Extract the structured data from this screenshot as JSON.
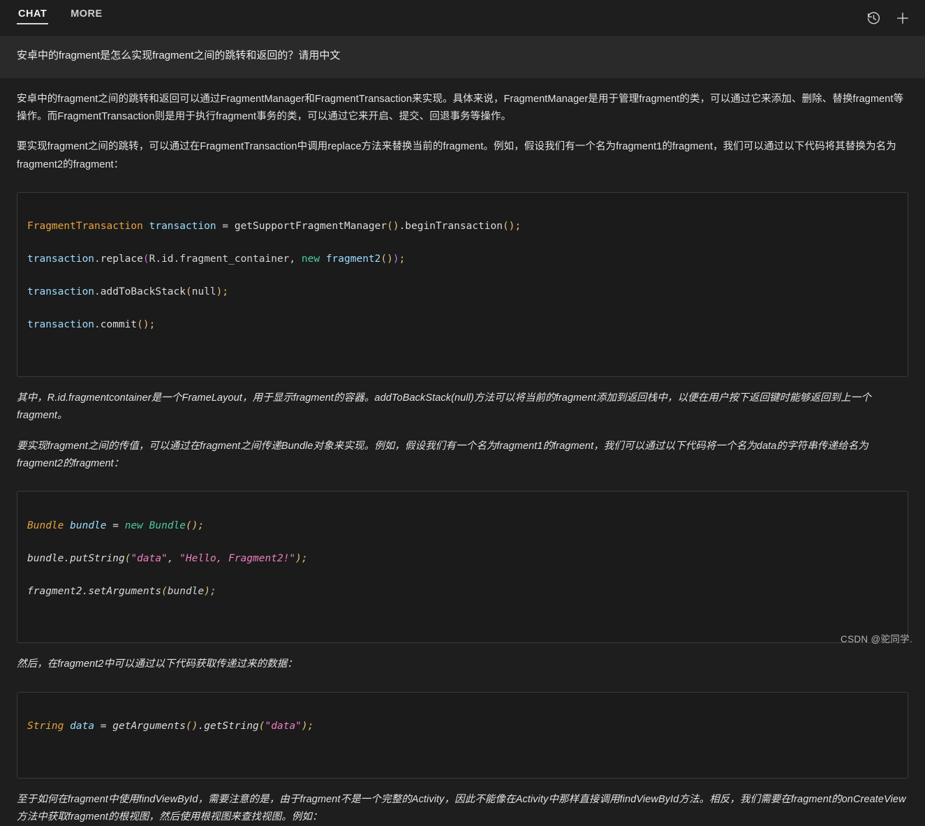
{
  "app": {
    "tabs": [
      {
        "label": "CHAT",
        "active": true
      },
      {
        "label": "MORE",
        "active": false
      }
    ],
    "actions": [
      {
        "name": "history-icon",
        "label": "History"
      },
      {
        "name": "new-chat-icon",
        "label": "New chat"
      }
    ],
    "colors": {
      "background": "#1e1e1e",
      "user_row_background": "#2a2a2a",
      "code_background": "#1b1b1b",
      "code_border": "#3a3a3a",
      "text": "#e3e3e3",
      "accent_type": "#e8a33d",
      "accent_variable": "#9cdcfe",
      "accent_keyword": "#4ec9a7",
      "accent_string": "#ef7ec0",
      "accent_paren": "#e5c07b"
    }
  },
  "conversation": {
    "user_question": "安卓中的fragment是怎么实现fragment之间的跳转和返回的？请用中文",
    "paragraphs": {
      "p1": "安卓中的fragment之间的跳转和返回可以通过FragmentManager和FragmentTransaction来实现。具体来说，FragmentManager是用于管理fragment的类，可以通过它来添加、删除、替换fragment等操作。而FragmentTransaction则是用于执行fragment事务的类，可以通过它来开启、提交、回退事务等操作。",
      "p2": "要实现fragment之间的跳转，可以通过在FragmentTransaction中调用replace方法来替换当前的fragment。例如，假设我们有一个名为fragment1的fragment，我们可以通过以下代码将其替换为名为fragment2的fragment：",
      "p3": "其中，R.id.fragmentcontainer是一个FrameLayout，用于显示fragment的容器。addToBackStack(null)方法可以将当前的fragment添加到返回栈中，以便在用户按下返回键时能够返回到上一个fragment。",
      "p4": "要实现fragment之间的传值，可以通过在fragment之间传递Bundle对象来实现。例如，假设我们有一个名为fragment1的fragment，我们可以通过以下代码将一个名为data的字符串传递给名为fragment2的fragment：",
      "p5": "然后，在fragment2中可以通过以下代码获取传递过来的数据：",
      "p6": "至于如何在fragment中使用findViewById，需要注意的是，由于fragment不是一个完整的Activity，因此不能像在Activity中那样直接调用findViewById方法。相反，我们需要在fragment的onCreateView方法中获取fragment的根视图，然后使用根视图来查找视图。例如："
    },
    "code_blocks": {
      "block1": {
        "language": "java",
        "italic": false,
        "lines": [
          "FragmentTransaction transaction = getSupportFragmentManager().beginTransaction();",
          "transaction.replace(R.id.fragment_container, new fragment2());",
          "transaction.addToBackStack(null);",
          "transaction.commit();"
        ]
      },
      "block2": {
        "language": "java",
        "italic": true,
        "lines": [
          "Bundle bundle = new Bundle();",
          "bundle.putString(\"data\", \"Hello, Fragment2!\");",
          "fragment2.setArguments(bundle);"
        ]
      },
      "block3": {
        "language": "java",
        "italic": true,
        "lines": [
          "String data = getArguments().getString(\"data\");"
        ]
      }
    }
  },
  "watermark": "CSDN @驼同学."
}
